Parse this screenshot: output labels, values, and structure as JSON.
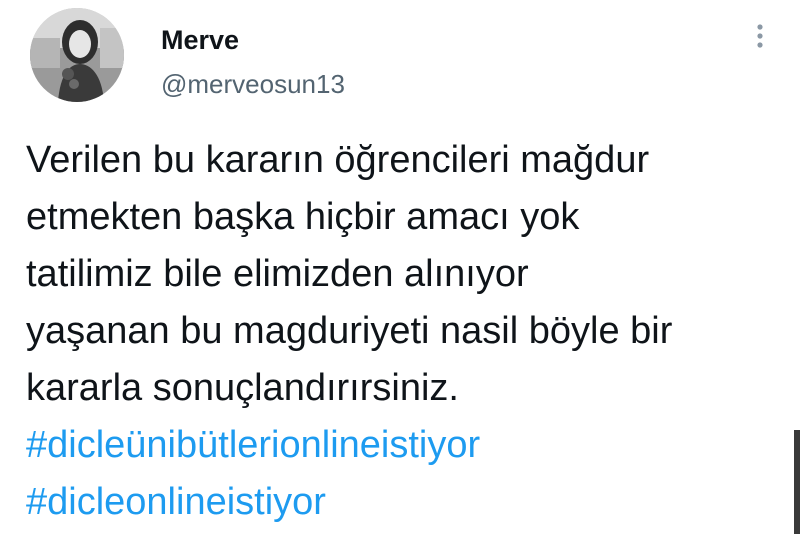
{
  "user": {
    "display_name": "Merve",
    "handle": "@merveosun13"
  },
  "tweet": {
    "lines": [
      "Verilen bu kararın öğrencileri mağdur",
      "etmekten başka hiçbir amacı yok",
      "tatilimiz bile elimizden alınıyor",
      "yaşanan bu magduriyeti nasil böyle bir",
      "kararla sonuçlandırırsiniz."
    ],
    "hashtags": [
      "#dicleünibütlerionlineistiyor",
      "#dicleonlineistiyor"
    ]
  },
  "icons": {
    "avatar": "profile-photo-grayscale",
    "more": "vertical-ellipsis-icon"
  },
  "colors": {
    "text": "#0f1419",
    "secondary": "#536471",
    "hashtag": "#1d9bf0",
    "background": "#ffffff"
  }
}
